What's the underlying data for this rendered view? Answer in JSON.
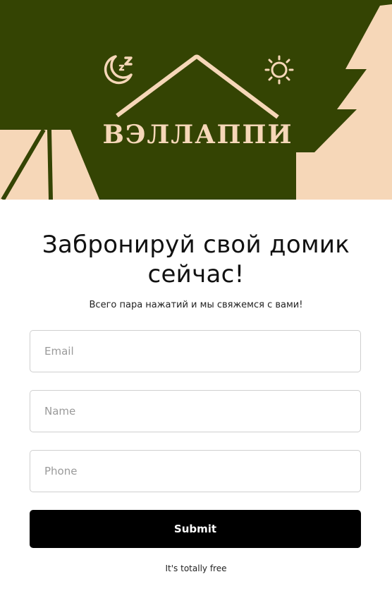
{
  "hero": {
    "brand": "ВЭЛЛАППИ",
    "colors": {
      "background": "#344403",
      "accent": "#f6d7b8"
    },
    "icons": [
      "moon-zzz-icon",
      "sun-icon",
      "house-roof-icon",
      "pine-tree-icon",
      "tent-icon"
    ]
  },
  "form": {
    "title": "Забронируй свой домик сейчас!",
    "subtitle": "Всего пара нажатий и мы свяжемся с вами!",
    "email_placeholder": "Email",
    "name_placeholder": "Name",
    "phone_placeholder": "Phone",
    "submit_label": "Submit",
    "note": "It's totally free"
  }
}
